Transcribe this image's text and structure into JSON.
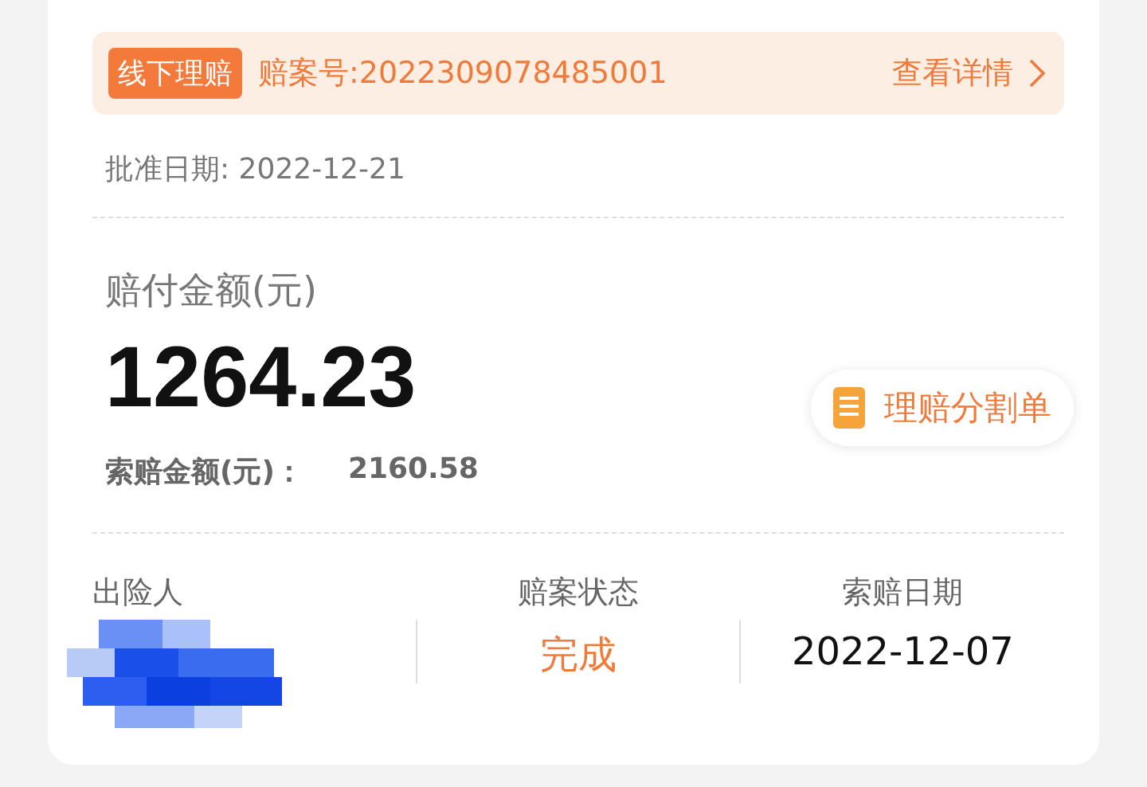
{
  "banner": {
    "tag": "线下理赔",
    "claim_no": "赔案号:2022309078485001",
    "link": "查看详情"
  },
  "approval_date": "批准日期: 2022-12-21",
  "payout": {
    "label": "赔付金额(元)",
    "amount": "1264.23",
    "claim_label": "索赔金额(元)：",
    "claim_amount": "2160.58"
  },
  "split_button": "理赔分割单",
  "columns": [
    {
      "label": "出险人",
      "value_hidden": true
    },
    {
      "label": "赔案状态",
      "value": "完成",
      "kind": "status"
    },
    {
      "label": "索赔日期",
      "value": "2022-12-07",
      "kind": "plain"
    }
  ]
}
